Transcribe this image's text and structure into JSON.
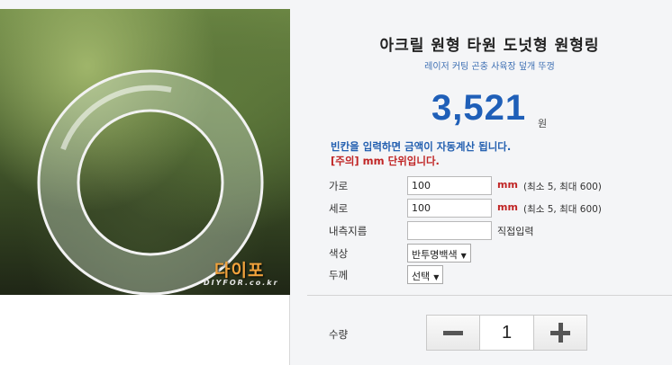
{
  "product": {
    "title": "아크릴 원형 타원 도넛형 원형링",
    "subtitle": "레이저 커팅 곤충 사육장 덮개 뚜껑",
    "price": "3,521",
    "price_unit": "원",
    "notice_auto_calc": "빈칸을 입력하면 금액이 자동계산 됩니다.",
    "notice_unit": "[주의] mm 단위입니다."
  },
  "image": {
    "logo_text": "다이포",
    "logo_sub": "DIYFOR.co.kr"
  },
  "form": {
    "width": {
      "label": "가로",
      "value": "100",
      "unit": "mm",
      "range": "(최소 5, 최대 600)"
    },
    "height": {
      "label": "세로",
      "value": "100",
      "unit": "mm",
      "range": "(최소 5, 최대 600)"
    },
    "inner_diameter": {
      "label": "내측지름",
      "value": "",
      "hint": "직접입력"
    },
    "color": {
      "label": "색상",
      "selected": "반투명백색"
    },
    "thickness": {
      "label": "두께",
      "selected": "선택"
    }
  },
  "quantity": {
    "label": "수량",
    "value": "1"
  }
}
